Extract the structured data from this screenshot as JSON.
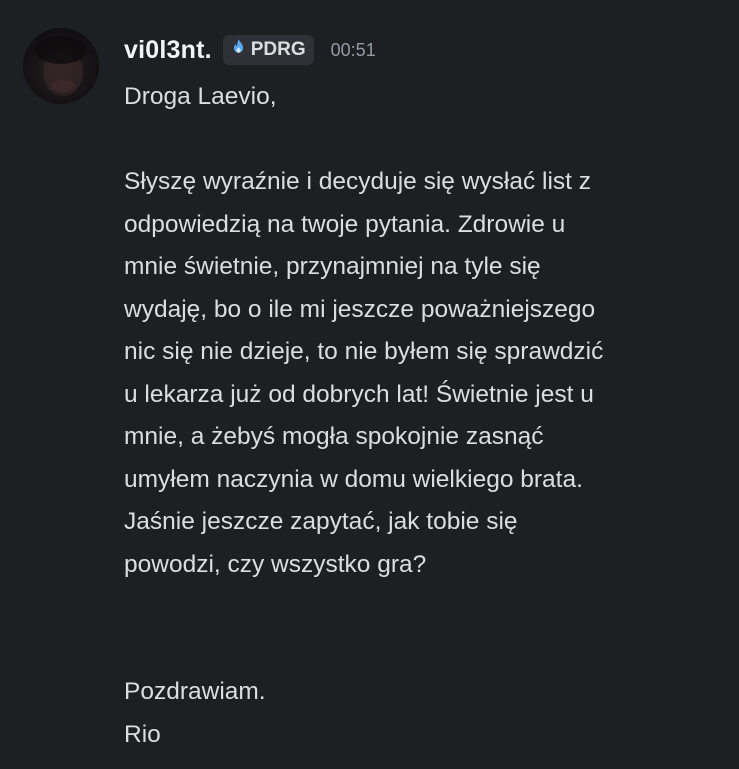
{
  "message": {
    "author": {
      "username": "vi0l3nt.",
      "tag": {
        "label": "PDRG",
        "icon": "flame-icon",
        "icon_color": "#5aa9f5"
      }
    },
    "timestamp": "00:51",
    "body": {
      "greeting": "Droga Laevio,",
      "paragraph_lines": [
        "Słyszę wyraźnie i decyduje się wysłać list z",
        "odpowiedzią na twoje pytania. Zdrowie u",
        "mnie świetnie, przynajmniej na tyle się",
        "wydaję, bo o ile mi jeszcze poważniejszego",
        "nic się nie dzieje, to nie byłem się sprawdzić",
        "u lekarza już od dobrych lat! Świetnie jest u",
        "mnie, a żebyś mogła spokojnie zasnąć",
        "umyłem naczynia w domu wielkiego brata.",
        "Jaśnie jeszcze zapytać, jak tobie się",
        "powodzi, czy wszystko gra?"
      ],
      "closing": "Pozdrawiam.",
      "signature": "Rio"
    }
  },
  "colors": {
    "background": "#1e1f22",
    "text": "#dbdee1",
    "username": "#f2f3f5",
    "timestamp": "#949ba4",
    "tag_background": "#2f3136"
  }
}
